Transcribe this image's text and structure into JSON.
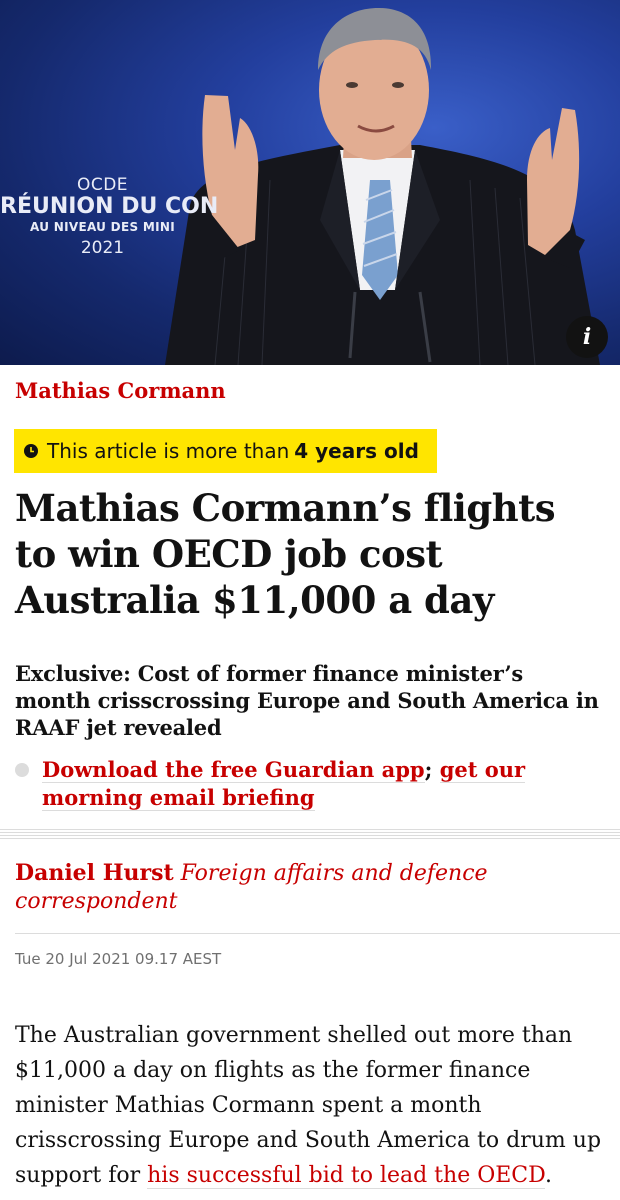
{
  "hero": {
    "banner": {
      "line1": "OCDE",
      "line2": "RÉUNION DU CON",
      "line3": "AU NIVEAU DES MINI",
      "line4": "2021"
    },
    "info_label": "i"
  },
  "article": {
    "kicker": "Mathias Cormann",
    "age_notice": {
      "prefix": "This article is more than",
      "age": "4 years old"
    },
    "headline": "Mathias Cormann’s flights to win OECD job cost Australia $11,000 a day",
    "standfirst": "Exclusive: Cost of former finance minister’s month crisscrossing Europe and South America in RAAF jet revealed",
    "promo": {
      "link1": "Download the free Guardian app",
      "separator": ";",
      "link2": "get our morning email briefing"
    },
    "byline": {
      "name": "Daniel Hurst",
      "role": "Foreign affairs and defence correspondent"
    },
    "dateline": "Tue 20 Jul 2021 09.17 AEST",
    "body": {
      "text": "The Australian government shelled out more than $11,000 a day on flights as the former finance minister Mathias Cormann spent a month crisscrossing Europe and South America to drum up support for ",
      "link": "his successful bid to lead the OECD",
      "end": "."
    }
  },
  "colors": {
    "accent_red": "#c70000",
    "age_badge_yellow": "#ffe500",
    "text": "#121212",
    "muted": "#707070"
  }
}
